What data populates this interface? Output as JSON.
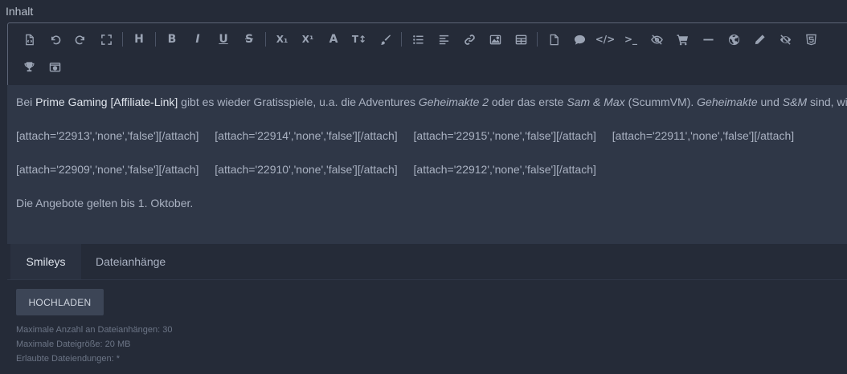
{
  "field_label": "Inhalt",
  "toolbar": {
    "row1": [
      {
        "name": "source-code-icon"
      },
      {
        "name": "undo-icon"
      },
      {
        "name": "redo-icon"
      },
      {
        "name": "fullscreen-icon"
      },
      {
        "sep": true
      },
      {
        "name": "heading-icon",
        "glyph": "H"
      },
      {
        "sep": true
      },
      {
        "name": "bold-icon",
        "glyph": "B"
      },
      {
        "name": "italic-icon",
        "glyph": "I"
      },
      {
        "name": "underline-icon",
        "glyph": "U"
      },
      {
        "name": "strikethrough-icon",
        "glyph": "S"
      },
      {
        "sep": true
      },
      {
        "name": "subscript-icon",
        "glyph": "X₁"
      },
      {
        "name": "superscript-icon",
        "glyph": "X¹"
      },
      {
        "name": "font-icon",
        "glyph": "A"
      },
      {
        "name": "font-size-icon",
        "glyph": "T↕"
      },
      {
        "name": "paint-brush-icon"
      },
      {
        "sep": true
      },
      {
        "name": "list-icon"
      },
      {
        "name": "align-left-icon"
      },
      {
        "name": "link-icon"
      },
      {
        "name": "image-icon"
      },
      {
        "name": "table-icon"
      },
      {
        "sep": true
      },
      {
        "name": "page-icon"
      },
      {
        "name": "quote-icon"
      },
      {
        "name": "code-icon",
        "glyph": "</>"
      },
      {
        "name": "terminal-icon",
        "glyph": ">_"
      },
      {
        "name": "spoiler-icon"
      },
      {
        "name": "cart-icon"
      },
      {
        "name": "horizontal-rule-icon"
      },
      {
        "name": "globe-icon"
      },
      {
        "name": "pencil-icon"
      },
      {
        "name": "eye-slash-icon"
      },
      {
        "name": "html5-icon"
      }
    ],
    "row2": [
      {
        "name": "trophy-icon"
      },
      {
        "name": "media-icon"
      }
    ]
  },
  "content": {
    "line1": {
      "bei": "Bei ",
      "link": "Prime Gaming [Affiliate-Link]",
      "t1": " gibt es wieder Gratisspiele, u.a. die Adventures ",
      "em1": "Geheimakte 2",
      "t2": " oder das erste ",
      "em2": "Sam & Max",
      "t3": " (ScummVM). ",
      "em3": "Geheimakte",
      "t4": " und ",
      "em4": "S&M",
      "t5": " sind, wie d"
    },
    "attach_row1": [
      "[attach='22913','none','false'][/attach]",
      "[attach='22914','none','false'][/attach]",
      "[attach='22915','none','false'][/attach]",
      "[attach='22911','none','false'][/attach]"
    ],
    "attach_row2": [
      "[attach='22909','none','false'][/attach]",
      "[attach='22910','none','false'][/attach]",
      "[attach='22912','none','false'][/attach]"
    ],
    "line4": "Die Angebote gelten bis 1. Oktober."
  },
  "tabs": [
    "Smileys",
    "Dateianhänge"
  ],
  "upload_label": "HOCHLADEN",
  "hints": [
    "Maximale Anzahl an Dateianhängen: 30",
    "Maximale Dateigröße: 20 MB",
    "Erlaubte Dateiendungen: *"
  ]
}
